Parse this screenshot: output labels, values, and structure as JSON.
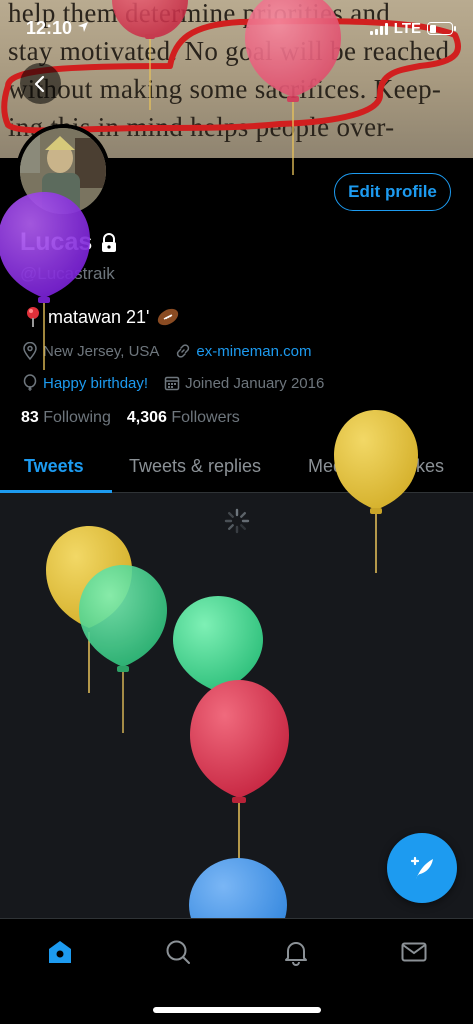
{
  "status_bar": {
    "time": "12:10",
    "network": "LTE"
  },
  "banner": {
    "lines": [
      "help them determine priorities and",
      "stay motivated. No goal will be reached",
      "without making some sacrifices. Keep-",
      "ing this in mind helps people over-"
    ]
  },
  "profile": {
    "name": "Lucas",
    "handle": "@Lucastraik",
    "bio": "matawan 21'",
    "location": "New Jersey, USA",
    "website": "ex-mineman.com",
    "birthday": "Happy birthday!",
    "joined": "Joined January 2016",
    "following_count": "83",
    "following_label": "Following",
    "followers_count": "4,306",
    "followers_label": "Followers",
    "edit_profile_label": "Edit profile"
  },
  "tabs": [
    {
      "label": "Tweets"
    },
    {
      "label": "Tweets & replies"
    },
    {
      "label": "Media"
    },
    {
      "label": "Likes"
    }
  ],
  "colors": {
    "accent": "#1d9bf0",
    "balloon_red": "#d9364f",
    "balloon_purple": "#8a2be2",
    "balloon_yellow": "#e3c23d",
    "balloon_green": "#3fd48c",
    "balloon_blue": "#3a8be0"
  },
  "icons": {
    "back": "chevron-left-icon",
    "lock": "lock-icon",
    "location": "location-pin-icon",
    "link": "link-icon",
    "birthday": "balloon-icon",
    "calendar": "calendar-icon",
    "compose": "compose-tweet-icon",
    "nav": [
      "home-icon",
      "search-icon",
      "notifications-icon",
      "messages-icon"
    ]
  }
}
